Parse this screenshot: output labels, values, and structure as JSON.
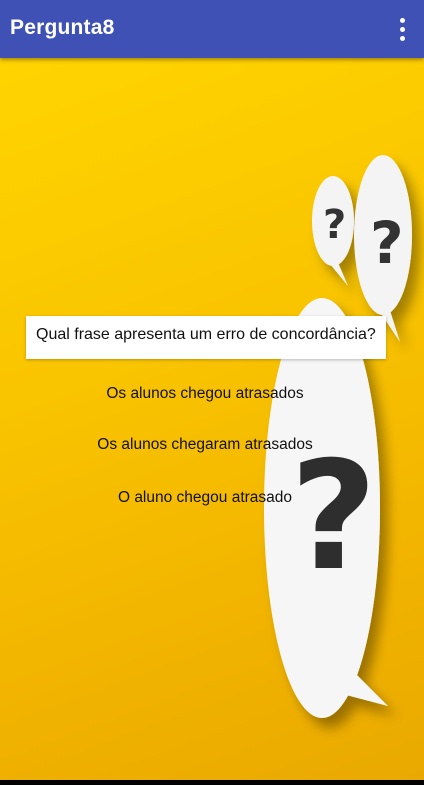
{
  "app_bar": {
    "title": "Pergunta8",
    "color": "#3f51b5",
    "menu_icon": "more-vert-icon"
  },
  "question": {
    "text": "Qual frase apresenta um erro de concordância?"
  },
  "options": [
    {
      "label": "Os alunos chegou atrasados"
    },
    {
      "label": "Os alunos chegaram atrasados"
    },
    {
      "label": "O aluno chegou atrasado"
    }
  ],
  "background": {
    "colors": [
      "#ffd400",
      "#e9a900"
    ],
    "decoration": "question-mark-speech-bubbles"
  }
}
